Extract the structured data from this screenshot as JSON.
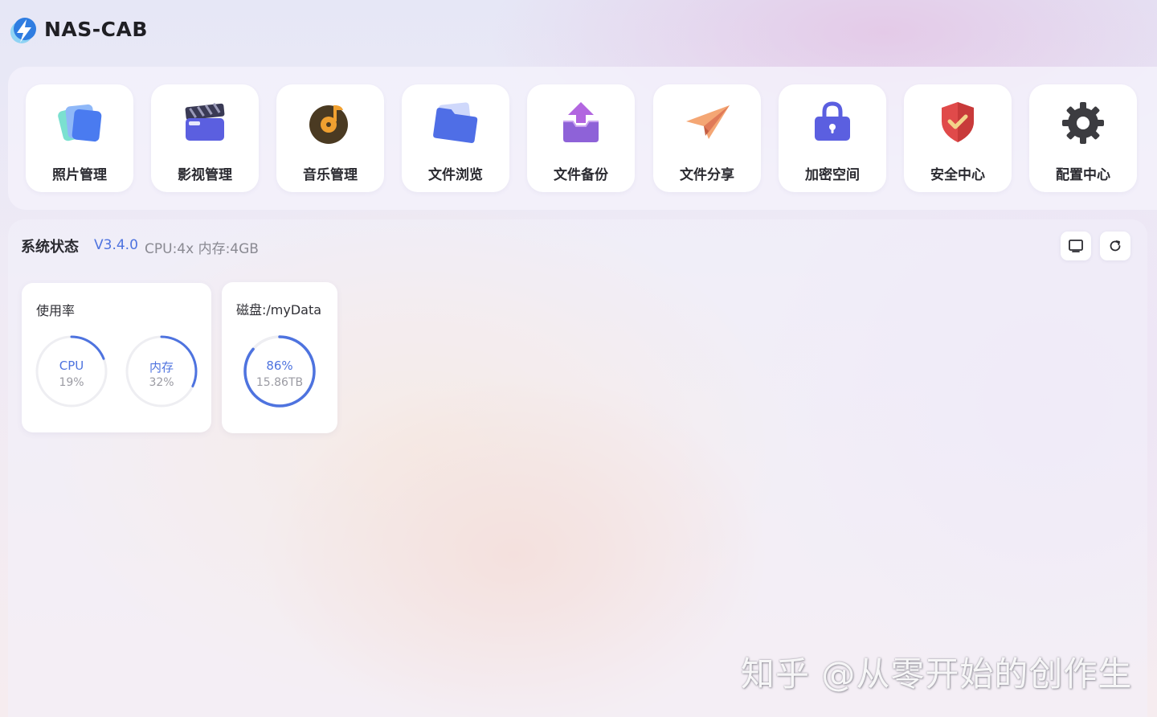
{
  "app": {
    "title": "NAS-CAB"
  },
  "apps": [
    {
      "label": "照片管理",
      "icon": "photos-icon"
    },
    {
      "label": "影视管理",
      "icon": "video-icon"
    },
    {
      "label": "音乐管理",
      "icon": "music-icon"
    },
    {
      "label": "文件浏览",
      "icon": "folder-icon"
    },
    {
      "label": "文件备份",
      "icon": "backup-icon"
    },
    {
      "label": "文件分享",
      "icon": "paper-plane-icon"
    },
    {
      "label": "加密空间",
      "icon": "lock-icon"
    },
    {
      "label": "安全中心",
      "icon": "shield-icon"
    },
    {
      "label": "配置中心",
      "icon": "gear-icon"
    }
  ],
  "status": {
    "title": "系统状态",
    "version": "V3.4.0",
    "spec": "CPU:4x 内存:4GB",
    "tools": [
      {
        "icon": "monitor-icon"
      },
      {
        "icon": "refresh-icon"
      }
    ]
  },
  "usage": {
    "title": "使用率",
    "cpu": {
      "label": "CPU",
      "value": "19%",
      "percent": 0.19
    },
    "memory": {
      "label": "内存",
      "value": "32%",
      "percent": 0.32
    }
  },
  "disk": {
    "title": "磁盘:/myData",
    "percent_text": "86%",
    "size": "15.86TB",
    "percent": 0.86
  },
  "watermark": "知乎 @从零开始的创作生",
  "colors": {
    "accent": "#4e73df",
    "track": "#eeeef2"
  }
}
